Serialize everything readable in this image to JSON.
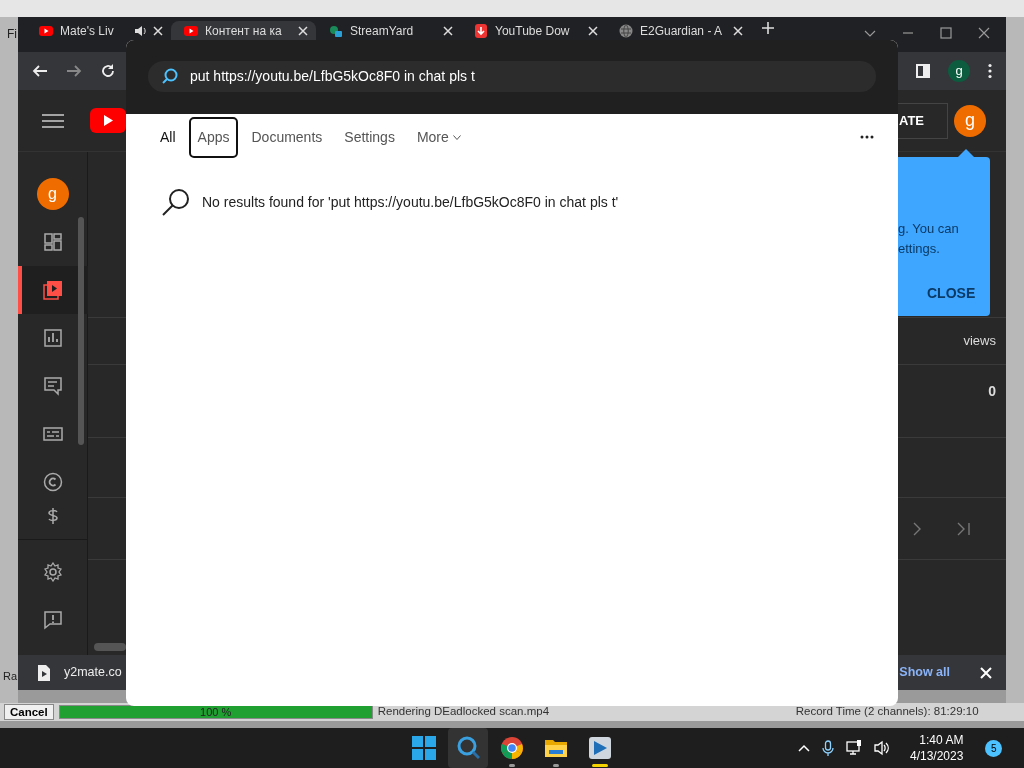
{
  "vegas": {
    "menu_text": "Fi",
    "track_text": "Ra",
    "status_bar": {
      "cancel": "Cancel",
      "progress": {
        "level": 1,
        "label": "100 %"
      },
      "message": "Rendering DEadlocked scan.mp4",
      "record_time": "Record Time (2 channels): 81:29:10"
    }
  },
  "browser": {
    "tabs": [
      {
        "label": "Mate's Liv",
        "audio": true,
        "selected": false
      },
      {
        "label": "Контент на ка",
        "audio": false,
        "selected": true
      },
      {
        "label": "StreamYard",
        "audio": false,
        "selected": false
      },
      {
        "label": "YouTube Dow",
        "audio": false,
        "selected": false
      },
      {
        "label": "E2Guardian - A",
        "audio": false,
        "selected": false
      }
    ],
    "profile": "g",
    "download_bar": {
      "file": "y2mate.co",
      "show_all": "Show all"
    }
  },
  "studio": {
    "sidebar": [
      {
        "kind": "avatar",
        "label": "g",
        "selected": false
      },
      {
        "kind": "dashboard",
        "selected": false
      },
      {
        "kind": "content",
        "selected": true
      },
      {
        "kind": "analytics",
        "selected": false
      },
      {
        "kind": "comments",
        "selected": false
      },
      {
        "kind": "subtitles",
        "selected": false
      },
      {
        "kind": "copyright",
        "selected": false
      },
      {
        "kind": "earn",
        "selected": false
      },
      {
        "kind": "settings",
        "selected": false
      },
      {
        "kind": "feedback",
        "selected": false
      }
    ],
    "create_button": "ATE",
    "avatar": "g",
    "tooltip": {
      "lines": [
        "g. You can",
        "ettings."
      ],
      "close": "CLOSE"
    },
    "column_header": "views",
    "cell_value": "0"
  },
  "search": {
    "query": "put https://youtu.be/LfbG5kOc8F0 in chat pls t",
    "filters": [
      {
        "label": "All",
        "selected": true,
        "focused": false,
        "dropdown": false
      },
      {
        "label": "Apps",
        "selected": false,
        "focused": true,
        "dropdown": false
      },
      {
        "label": "Documents",
        "selected": false,
        "focused": false,
        "dropdown": false
      },
      {
        "label": "Settings",
        "selected": false,
        "focused": false,
        "dropdown": false
      },
      {
        "label": "More",
        "selected": false,
        "focused": false,
        "dropdown": true
      }
    ],
    "message": "No results found for 'put https://youtu.be/LfbG5kOc8F0 in chat pls t'"
  },
  "taskbar": {
    "apps": [
      {
        "kind": "start",
        "running": false,
        "foreground": false,
        "active": false
      },
      {
        "kind": "search",
        "running": false,
        "foreground": false,
        "active": true
      },
      {
        "kind": "chrome",
        "running": true,
        "foreground": false,
        "active": false
      },
      {
        "kind": "explorer",
        "running": true,
        "foreground": false,
        "active": false
      },
      {
        "kind": "vegas",
        "running": true,
        "foreground": true,
        "active": false
      }
    ],
    "time": "1:40 AM",
    "date": "4/13/2023",
    "notifications": "5"
  }
}
